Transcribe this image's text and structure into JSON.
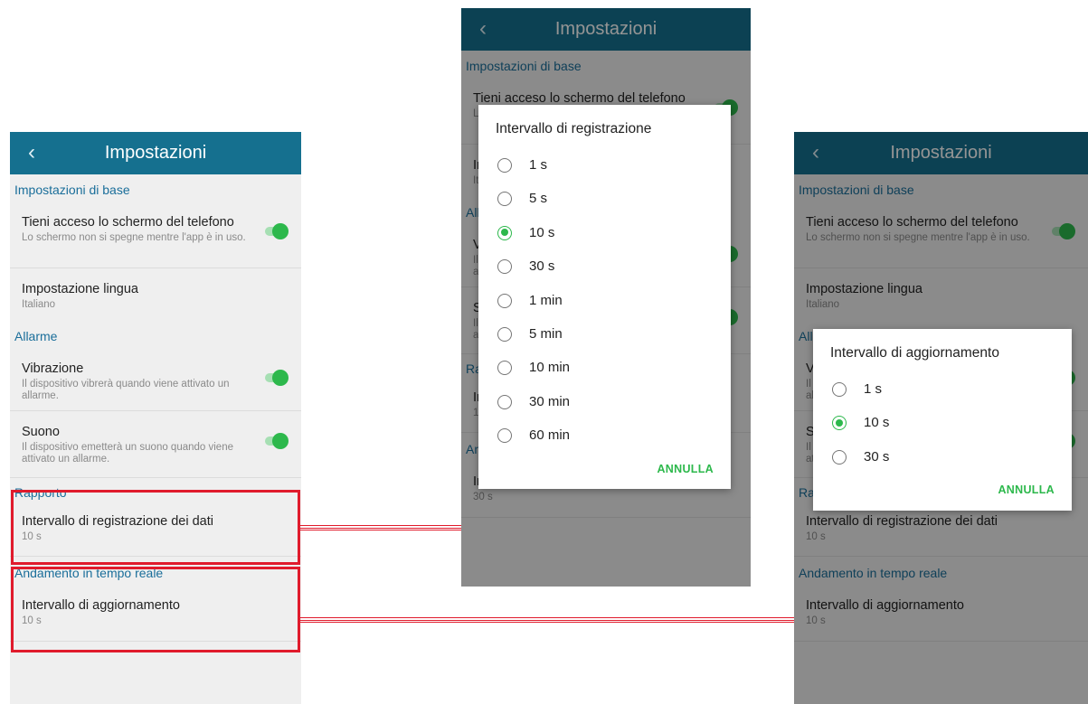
{
  "app": {
    "title": "Impostazioni",
    "back_icon": "chevron-left-icon"
  },
  "settings": {
    "section_base": "Impostazioni di base",
    "screen_on": {
      "title": "Tieni acceso lo schermo del telefono",
      "subtitle": "Lo schermo non si spegne mentre l'app è in uso.",
      "enabled": true
    },
    "language": {
      "title": "Impostazione lingua",
      "value": "Italiano"
    },
    "section_alarm": "Allarme",
    "vibration": {
      "title": "Vibrazione",
      "subtitle": "Il dispositivo vibrerà quando viene attivato un allarme.",
      "enabled": true
    },
    "sound": {
      "title": "Suono",
      "subtitle": "Il dispositivo emetterà un suono quando viene attivato un allarme.",
      "enabled": true
    },
    "section_report": "Rapporto",
    "record_interval": {
      "title": "Intervallo di registrazione dei dati",
      "value": "10 s"
    },
    "section_trend": "Andamento in tempo reale",
    "update_interval": {
      "title": "Intervallo di aggiornamento",
      "value": "10 s"
    }
  },
  "middle_screen": {
    "update_interval_value": "30 s",
    "dialog": {
      "title": "Intervallo di registrazione",
      "options": [
        "1 s",
        "5 s",
        "10 s",
        "30 s",
        "1 min",
        "5 min",
        "10 min",
        "30 min",
        "60 min"
      ],
      "selected": "10 s",
      "cancel": "ANNULLA"
    }
  },
  "right_screen": {
    "dialog": {
      "title": "Intervallo di aggiornamento",
      "options": [
        "1 s",
        "10 s",
        "30 s"
      ],
      "selected": "10 s",
      "cancel": "ANNULLA"
    }
  },
  "colors": {
    "appbar": "#15708f",
    "section_text": "#1a6e9a",
    "accent_green": "#2db84c",
    "highlight_red": "#e01b2c",
    "background": "#efefef"
  }
}
